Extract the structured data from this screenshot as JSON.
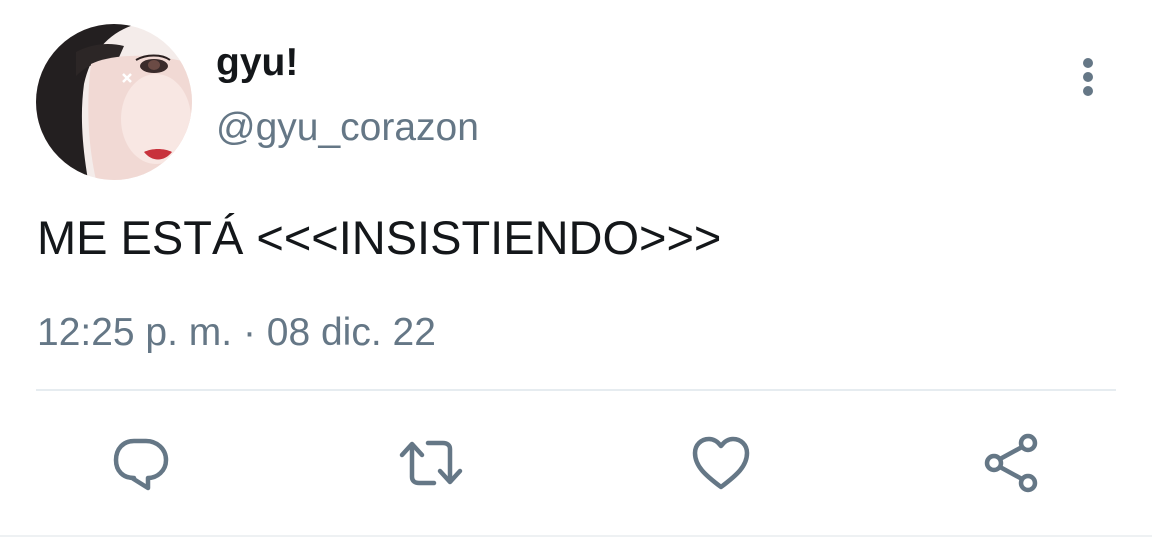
{
  "tweet": {
    "author": {
      "display_name": "gyu!",
      "handle": "@gyu_corazon"
    },
    "text": "ME ESTÁ <<<INSISTIENDO>>>",
    "meta": "12:25 p. m. · 08 dic. 22"
  },
  "icons": {
    "more": "more-vertical-icon",
    "reply": "reply-icon",
    "retweet": "retweet-icon",
    "like": "heart-icon",
    "share": "share-icon"
  },
  "colors": {
    "text_primary": "#14171a",
    "text_secondary": "#657786",
    "icon": "#657786",
    "divider": "#e6ecf0"
  }
}
